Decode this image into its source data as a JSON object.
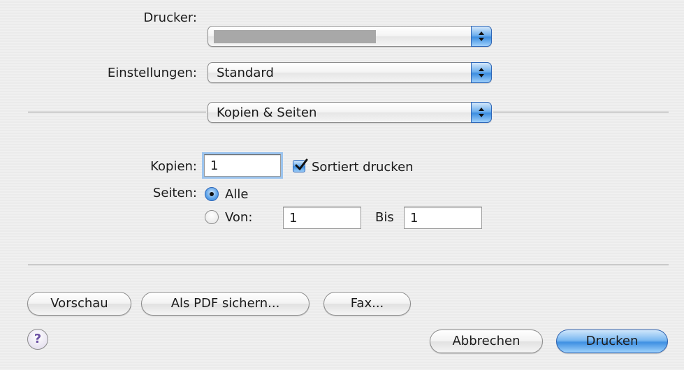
{
  "printer": {
    "label": "Drucker:",
    "value": ""
  },
  "presets": {
    "label": "Einstellungen:",
    "value": "Standard"
  },
  "pane": {
    "value": "Kopien & Seiten"
  },
  "copies": {
    "label": "Kopien:",
    "value": "1",
    "collate_label": "Sortiert drucken",
    "collate_checked": true
  },
  "pages": {
    "label": "Seiten:",
    "all_label": "Alle",
    "all_selected": true,
    "from_label": "Von:",
    "from_value": "1",
    "to_label": "Bis",
    "to_value": "1"
  },
  "buttons": {
    "preview": "Vorschau",
    "save_pdf": "Als PDF sichern...",
    "fax": "Fax...",
    "help": "?",
    "cancel": "Abbrechen",
    "print": "Drucken"
  },
  "colors": {
    "accent": "#3d8ee0",
    "background": "#ededed"
  },
  "icons": [
    "stepper-arrows-icon",
    "checkmark-icon",
    "help-icon"
  ]
}
